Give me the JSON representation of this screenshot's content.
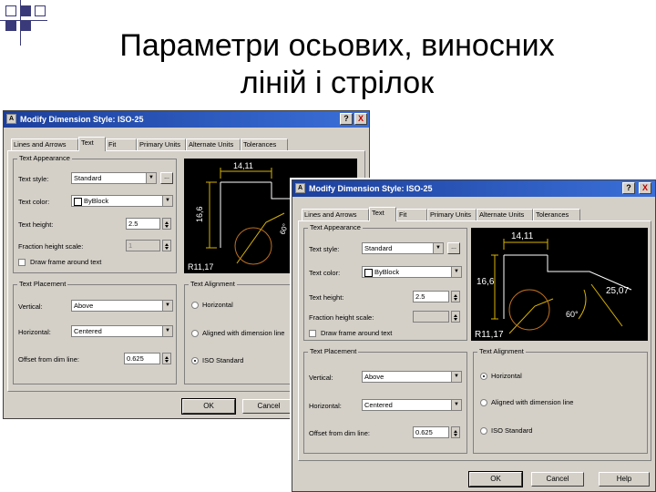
{
  "slide": {
    "title_line1": "Параметри осьових, виносних",
    "title_line2": "ліній і стрілок"
  },
  "dialog_back": {
    "title": "Modify Dimension Style: ISO-25",
    "help_label": "?",
    "close_label": "X",
    "tabs": [
      "Lines and Arrows",
      "Text",
      "Fit",
      "Primary Units",
      "Alternate Units",
      "Tolerances"
    ],
    "active_tab": "Text",
    "text_appearance": {
      "title": "Text Appearance",
      "text_style_label": "Text style:",
      "text_style_value": "Standard",
      "text_color_label": "Text color:",
      "text_color_value": "ByBlock",
      "text_height_label": "Text height:",
      "text_height_value": "2.5",
      "fraction_label": "Fraction height scale:",
      "fraction_value": "1",
      "frame_label": "Draw frame around text"
    },
    "text_placement": {
      "title": "Text Placement",
      "vertical_label": "Vertical:",
      "vertical_value": "Above",
      "horizontal_label": "Horizontal:",
      "horizontal_value": "Centered",
      "offset_label": "Offset from dim line:",
      "offset_value": "0.625"
    },
    "text_alignment": {
      "title": "Text Alignment",
      "options": [
        "Horizontal",
        "Aligned with dimension line",
        "ISO Standard"
      ],
      "selected_index": 2
    },
    "preview_labels": [
      "14,11",
      "16,6",
      "R11,17",
      "60°"
    ],
    "buttons": {
      "ok": "OK",
      "cancel": "Cancel"
    }
  },
  "dialog_front": {
    "title": "Modify Dimension Style: ISO-25",
    "help_label": "?",
    "close_label": "X",
    "tabs": [
      "Lines and Arrows",
      "Text",
      "Fit",
      "Primary Units",
      "Alternate Units",
      "Tolerances"
    ],
    "active_tab": "Text",
    "text_appearance": {
      "title": "Text Appearance",
      "text_style_label": "Text style:",
      "text_style_value": "Standard",
      "text_color_label": "Text color:",
      "text_color_value": "ByBlock",
      "text_height_label": "Text height:",
      "text_height_value": "2.5",
      "fraction_label": "Fraction height scale:",
      "fraction_value": "",
      "frame_label": "Draw frame around text"
    },
    "text_placement": {
      "title": "Text Placement",
      "vertical_label": "Vertical:",
      "vertical_value": "Above",
      "horizontal_label": "Horizontal:",
      "horizontal_value": "Centered",
      "offset_label": "Offset from dim line:",
      "offset_value": "0.625"
    },
    "text_alignment": {
      "title": "Text Alignment",
      "options": [
        "Horizontal",
        "Aligned with dimension line",
        "ISO Standard"
      ],
      "selected_index": 0
    },
    "preview_labels": [
      "14,11",
      "16,6",
      "25,07",
      "60°",
      "R11,17"
    ],
    "buttons": {
      "ok": "OK",
      "cancel": "Cancel",
      "help": "Help"
    }
  },
  "colors": {
    "titlebar": "#1c3f9b",
    "dialog_face": "#d4d0c8",
    "preview_bg": "#000000",
    "preview_lines": "#ffffff",
    "preview_dims": "#d9b400",
    "preview_circle": "#c07020",
    "slide_decoration": "#3a3a7a"
  }
}
